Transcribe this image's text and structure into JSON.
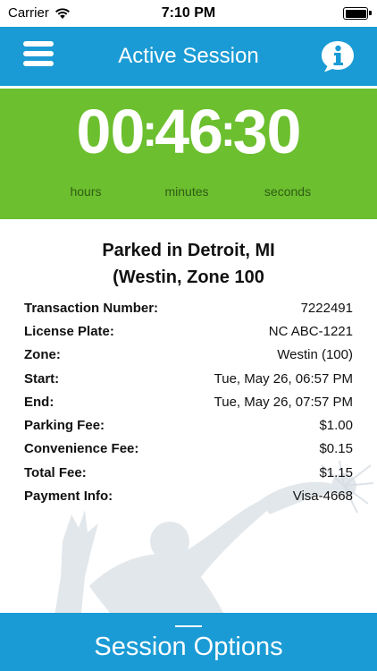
{
  "status_bar": {
    "carrier": "Carrier",
    "time": "7:10 PM",
    "wifi_icon": "wifi-icon",
    "battery_icon": "battery-icon"
  },
  "nav": {
    "title": "Active Session",
    "menu_icon": "menu-icon",
    "info_icon": "info-icon",
    "color": "#1b9bd5"
  },
  "timer": {
    "hours": "00",
    "minutes": "46",
    "seconds": "30",
    "separator": ":",
    "hours_label": "hours",
    "minutes_label": "minutes",
    "seconds_label": "seconds",
    "color": "#6cbf2e"
  },
  "parking": {
    "title_line1": "Parked in Detroit, MI",
    "title_line2": "(Westin, Zone 100",
    "rows": [
      {
        "label": "Transaction Number:",
        "value": "7222491"
      },
      {
        "label": "License Plate:",
        "value": "NC ABC-1221"
      },
      {
        "label": "Zone:",
        "value": "Westin (100)"
      },
      {
        "label": "Start:",
        "value": "Tue, May 26, 06:57 PM"
      },
      {
        "label": "End:",
        "value": "Tue, May 26, 07:57 PM"
      },
      {
        "label": "Parking Fee:",
        "value": "$1.00"
      },
      {
        "label": "Convenience Fee:",
        "value": "$0.15"
      },
      {
        "label": "Total Fee:",
        "value": "$1.15"
      },
      {
        "label": "Payment Info:",
        "value": "Visa-4668"
      }
    ]
  },
  "session_options": {
    "label": "Session Options"
  }
}
